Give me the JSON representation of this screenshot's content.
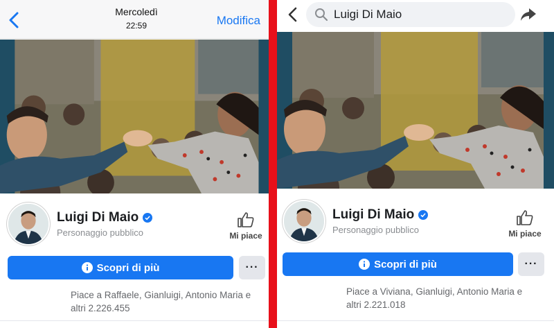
{
  "left": {
    "header": {
      "day": "Mercoledì",
      "time": "22:59",
      "edit_label": "Modifica",
      "back_icon": "chevron-left-icon"
    },
    "profile": {
      "name": "Luigi Di Maio",
      "category": "Personaggio pubblico",
      "like_label": "Mi piace",
      "primary_button": "Scopri di più",
      "more_button": "···",
      "likes_line1": "Piace a Raffaele, Gianluigi, Antonio Maria e",
      "likes_line2": "altri 2.226.455"
    }
  },
  "right": {
    "header": {
      "search_value": "Luigi Di Maio",
      "back_icon": "chevron-left-icon",
      "share_icon": "share-arrow-icon"
    },
    "profile": {
      "name": "Luigi Di Maio",
      "category": "Personaggio pubblico",
      "like_label": "Mi piace",
      "primary_button": "Scopri di più",
      "more_button": "···",
      "likes_line1": "Piace a Viviana, Gianluigi, Antonio Maria e",
      "likes_line2": "altri 2.221.018"
    }
  },
  "colors": {
    "facebook_blue": "#1877f2",
    "divider_red": "#e8101a",
    "secondary_text": "#65676b"
  }
}
